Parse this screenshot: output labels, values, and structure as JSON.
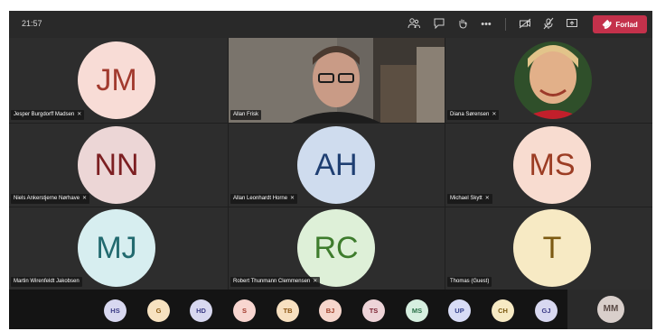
{
  "topbar": {
    "time": "21:57",
    "icons": [
      "people-icon",
      "chat-icon",
      "raise-hand-icon",
      "more-icon",
      "camera-off-icon",
      "mic-off-icon",
      "share-screen-icon"
    ],
    "leave_label": "Forlad"
  },
  "participants": [
    {
      "initials": "JM",
      "name": "Jesper Burgdorff Madsen",
      "muted": true,
      "bg": "#f8dcd6",
      "fg": "#a23a2e"
    },
    {
      "initials": "",
      "name": "Allan Frisk",
      "muted": false,
      "video": true
    },
    {
      "initials": "",
      "name": "Diana Sørensen",
      "muted": true,
      "video": true
    },
    {
      "initials": "NN",
      "name": "Niels Ankerstjerne Nørhave",
      "muted": true,
      "bg": "#ecd6d6",
      "fg": "#7c1f22"
    },
    {
      "initials": "AH",
      "name": "Allan Leonhardt Horne",
      "muted": true,
      "bg": "#cfdcee",
      "fg": "#1f3f72"
    },
    {
      "initials": "MS",
      "name": "Michael Skytt",
      "muted": true,
      "bg": "#f8dcd0",
      "fg": "#9c3d24"
    },
    {
      "initials": "MJ",
      "name": "Martin Wirenfeldt Jakobsen",
      "muted": false,
      "bg": "#d7eef0",
      "fg": "#226a6f"
    },
    {
      "initials": "RC",
      "name": "Robert Thunmann Clemmensen",
      "muted": true,
      "bg": "#def0d8",
      "fg": "#3e7c2d"
    },
    {
      "initials": "T",
      "name": "Thomas (Guest)",
      "muted": false,
      "bg": "#f7eac4",
      "fg": "#7c5a12"
    }
  ],
  "dock": [
    {
      "initials": "HS",
      "bg": "#d8d8f0",
      "fg": "#3c3c86"
    },
    {
      "initials": "G",
      "bg": "#f7e2c0",
      "fg": "#8a5a12"
    },
    {
      "initials": "HD",
      "bg": "#d8d8f0",
      "fg": "#3c3c86"
    },
    {
      "initials": "S",
      "bg": "#f8d6d0",
      "fg": "#a0382a"
    },
    {
      "initials": "TB",
      "bg": "#f7e0c0",
      "fg": "#8a5412"
    },
    {
      "initials": "BJ",
      "bg": "#f6d6cc",
      "fg": "#a0402a"
    },
    {
      "initials": "TS",
      "bg": "#eed4d8",
      "fg": "#7a2030"
    },
    {
      "initials": "MS",
      "bg": "#d6efe0",
      "fg": "#2a7048"
    },
    {
      "initials": "UP",
      "bg": "#d8dcf6",
      "fg": "#34408c"
    },
    {
      "initials": "CH",
      "bg": "#f7eac4",
      "fg": "#7c5a12"
    },
    {
      "initials": "GJ",
      "bg": "#d8d8f0",
      "fg": "#3c3c86"
    }
  ],
  "self": {
    "initials": "MM"
  }
}
